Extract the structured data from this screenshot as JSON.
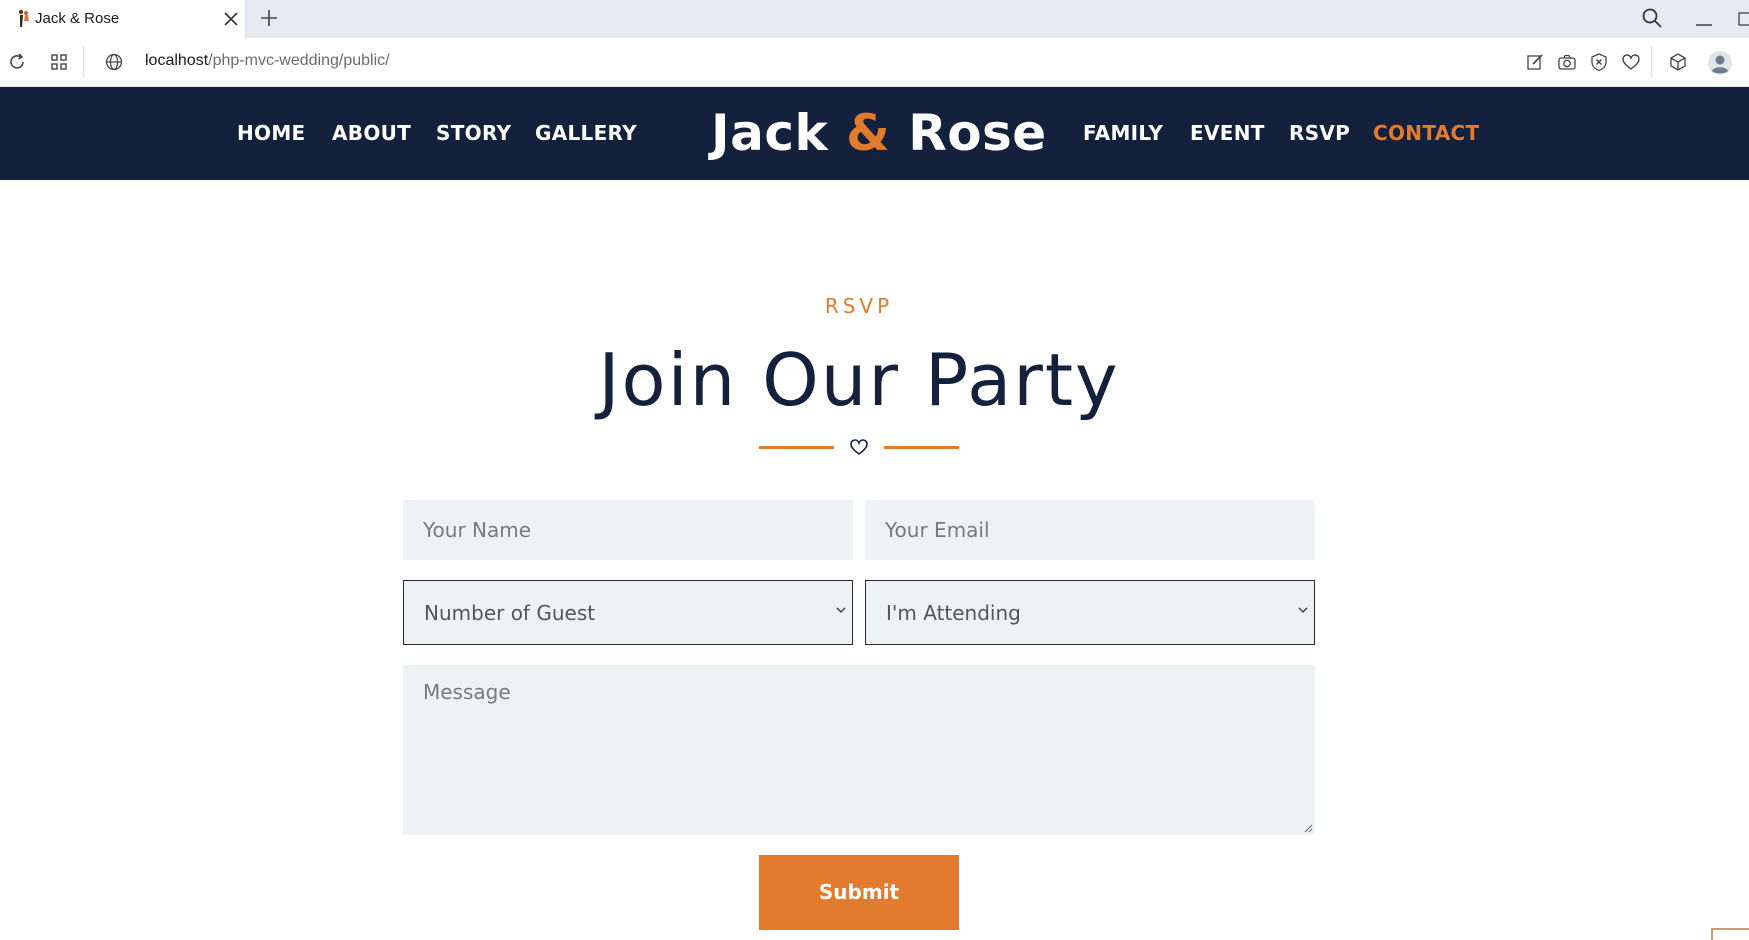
{
  "browser": {
    "tab_title": "Jack & Rose",
    "url_host": "localhost",
    "url_path": "/php-mvc-wedding/public/"
  },
  "nav": {
    "left": [
      "HOME",
      "ABOUT",
      "STORY",
      "GALLERY"
    ],
    "right": [
      "FAMILY",
      "EVENT",
      "RSVP",
      "CONTACT"
    ],
    "active": "CONTACT",
    "brand_first": "Jack",
    "brand_amp": "&",
    "brand_second": "Rose"
  },
  "section": {
    "eyebrow": "RSVP",
    "heading": "Join Our Party"
  },
  "form": {
    "name_placeholder": "Your Name",
    "email_placeholder": "Your Email",
    "guests_selected": "Number of Guest",
    "attending_selected": "I'm Attending",
    "message_placeholder": "Message",
    "submit_label": "Submit"
  },
  "colors": {
    "navy": "#14213d",
    "accent": "#e27b2e",
    "field_bg": "#edf3f4"
  }
}
